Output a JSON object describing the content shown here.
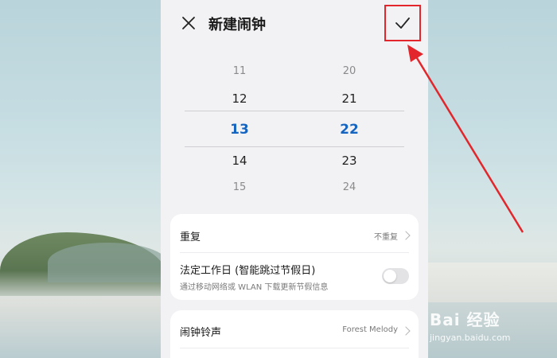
{
  "header": {
    "title": "新建闹钟",
    "close_icon": "close-icon",
    "confirm_icon": "check-icon"
  },
  "picker": {
    "hours": [
      "11",
      "12",
      "13",
      "14",
      "15"
    ],
    "minutes": [
      "20",
      "21",
      "22",
      "23",
      "24"
    ],
    "selected_color": "#1565c0"
  },
  "settings": {
    "repeat_label": "重复",
    "repeat_value": "不重复",
    "workday_label": "法定工作日 (智能跳过节假日)",
    "workday_sub": "通过移动网络或 WLAN 下载更新节假信息",
    "workday_enabled": false,
    "ringtone_label": "闹钟铃声",
    "ringtone_value": "Forest Melody"
  },
  "annotation": {
    "color": "#e2262b"
  },
  "watermark": {
    "main": "Bai 经验",
    "sub": "jingyan.baidu.com"
  }
}
